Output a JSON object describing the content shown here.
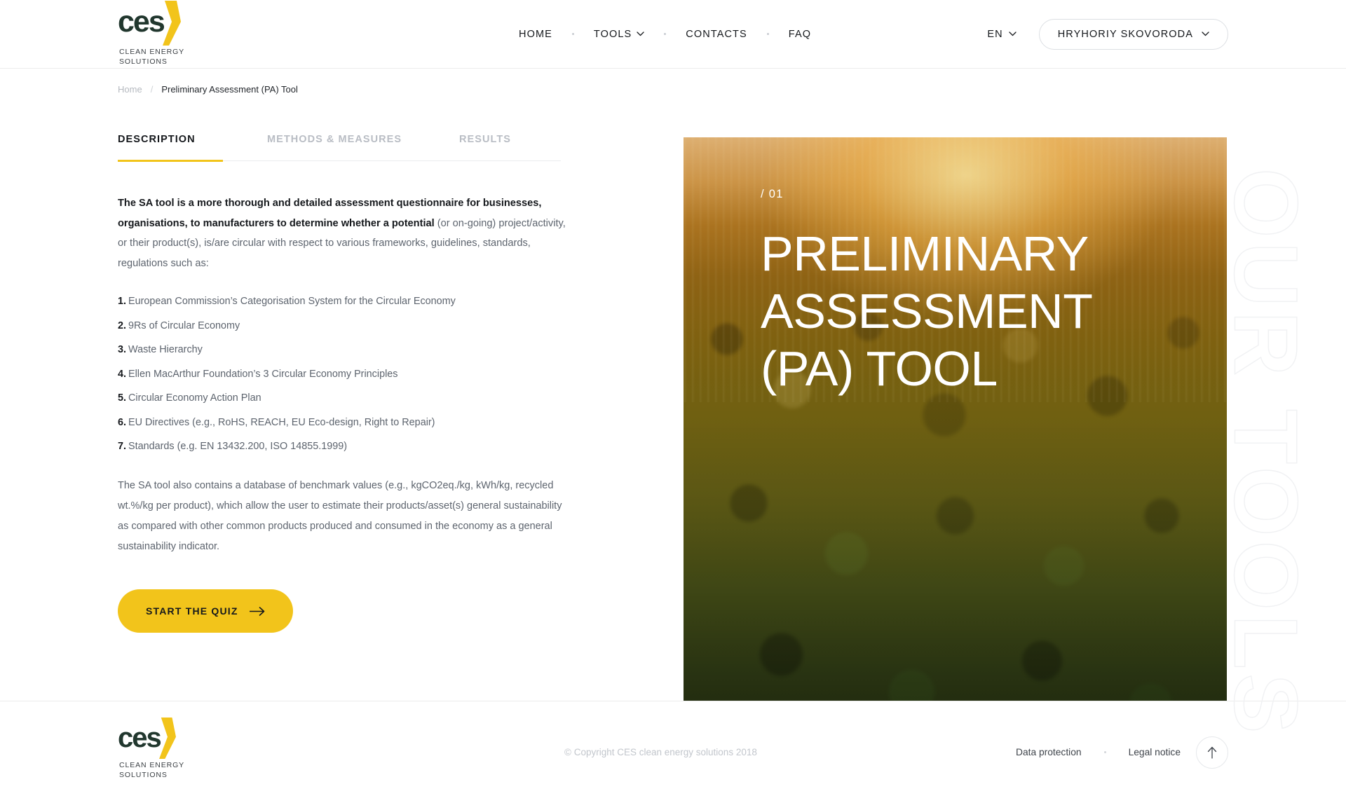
{
  "brand": {
    "logo_text": "ces",
    "logo_sub_line1": "CLEAN ENERGY",
    "logo_sub_line2": "SOLUTIONS",
    "accent_color": "#f2c41b",
    "dark_color": "#21372e"
  },
  "header": {
    "nav": [
      {
        "label": "HOME",
        "caret": false
      },
      {
        "label": "TOOLS",
        "caret": true
      },
      {
        "label": "CONTACTS",
        "caret": false
      },
      {
        "label": "FAQ",
        "caret": false
      }
    ],
    "language": "EN",
    "user_name": "HRYHORIY SKOVORODA"
  },
  "breadcrumb": {
    "home": "Home",
    "separator": "/",
    "current": "Preliminary Assessment (PA) Tool"
  },
  "tabs": [
    {
      "label": "DESCRIPTION",
      "active": true
    },
    {
      "label": "METHODS & MEASURES",
      "active": false
    },
    {
      "label": "RESULTS",
      "active": false
    }
  ],
  "description": {
    "lead_bold": "The SA tool is a more thorough and detailed assessment questionnaire for businesses, organisations, to manufacturers to determine whether a potential",
    "lead_rest": " (or on-going) project/activity, or their product(s), is/are circular with respect to various frameworks, guidelines, standards, regulations such as:",
    "items": [
      {
        "num": "1.",
        "text": "European Commission’s Categorisation System for the Circular Economy"
      },
      {
        "num": "2.",
        "text": "9Rs of Circular Economy"
      },
      {
        "num": "3.",
        "text": "Waste Hierarchy"
      },
      {
        "num": "4.",
        "text": "Ellen MacArthur Foundation’s 3 Circular Economy Principles"
      },
      {
        "num": "5.",
        "text": "Circular Economy Action Plan"
      },
      {
        "num": "6.",
        "text": "EU Directives (e.g., RoHS, REACH, EU Eco-design, Right to Repair)"
      },
      {
        "num": "7.",
        "text": "Standards (e.g. EN 13432.200, ISO 14855.1999)"
      }
    ],
    "paragraph2": "The SA tool also contains a database of benchmark values (e.g., kgCO2eq./kg, kWh/kg, recycled wt.%/kg per product), which allow the user to estimate their products/asset(s) general sustainability as compared with other common products produced and consumed in the economy as a general sustainability indicator.",
    "cta_label": "START THE QUIZ"
  },
  "hero": {
    "number": "/ 01",
    "title": "PRELIMINARY ASSESSMENT (PA) TOOL",
    "watermark": "OUR TOOLS"
  },
  "footer": {
    "copyright": "© Copyright CES clean energy solutions 2018",
    "links": [
      {
        "label": "Data protection"
      },
      {
        "label": "Legal notice"
      }
    ]
  }
}
